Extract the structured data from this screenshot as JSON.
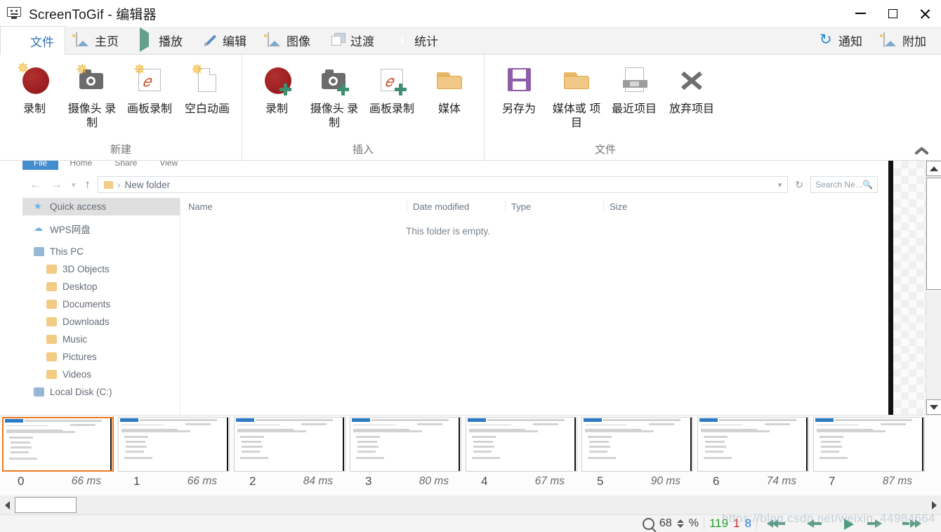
{
  "window": {
    "title": "ScreenToGif - 编辑器",
    "app_icon": "monitor-icon",
    "minimize_label": "最小化",
    "maximize_label": "最大化",
    "close_label": "关闭"
  },
  "ribbon": {
    "tabs": [
      {
        "label": "文件",
        "icon": "save-icon",
        "active": true
      },
      {
        "label": "主页",
        "icon": "picture-icon",
        "active": false
      },
      {
        "label": "播放",
        "icon": "play-icon",
        "active": false
      },
      {
        "label": "编辑",
        "icon": "pencil-icon",
        "active": false
      },
      {
        "label": "图像",
        "icon": "image-icon",
        "active": false
      },
      {
        "label": "过渡",
        "icon": "transition-icon",
        "active": false
      },
      {
        "label": "统计",
        "icon": "info-icon",
        "active": false
      }
    ],
    "right_tabs": [
      {
        "label": "通知",
        "icon": "notification-icon"
      },
      {
        "label": "附加",
        "icon": "addon-icon"
      }
    ],
    "collapse_icon": "chevron-up-icon",
    "groups": [
      {
        "label": "新建",
        "items": [
          {
            "label": "录制",
            "icon": "new-record-icon"
          },
          {
            "label": "摄像头\n录制",
            "icon": "new-webcam-icon"
          },
          {
            "label": "画板录制",
            "icon": "new-board-icon"
          },
          {
            "label": "空白动画",
            "icon": "new-blank-icon"
          }
        ]
      },
      {
        "label": "插入",
        "items": [
          {
            "label": "录制",
            "icon": "insert-record-icon"
          },
          {
            "label": "摄像头\n录制",
            "icon": "insert-webcam-icon"
          },
          {
            "label": "画板录制",
            "icon": "insert-board-icon"
          },
          {
            "label": "媒体",
            "icon": "insert-media-icon"
          }
        ]
      },
      {
        "label": "文件",
        "items": [
          {
            "label": "另存为",
            "icon": "save-as-icon"
          },
          {
            "label": "媒体或\n项目",
            "icon": "open-media-icon"
          },
          {
            "label": "最近项目",
            "icon": "recent-project-icon"
          },
          {
            "label": "放弃项目",
            "icon": "discard-project-icon"
          }
        ]
      }
    ]
  },
  "preview": {
    "explorer": {
      "tabs": [
        "File",
        "Home",
        "Share",
        "View"
      ],
      "address": "New folder",
      "search_placeholder": "Search Ne...",
      "refresh_icon": "refresh-icon",
      "sidebar": [
        {
          "label": "Quick access",
          "icon": "star-icon",
          "selected": true,
          "indent": false
        },
        {
          "label": "WPS网盘",
          "icon": "cloud-icon",
          "selected": false,
          "indent": false
        },
        {
          "label": "This PC",
          "icon": "pc-icon",
          "selected": false,
          "indent": false
        },
        {
          "label": "3D Objects",
          "icon": "folder-3d-icon",
          "selected": false,
          "indent": true
        },
        {
          "label": "Desktop",
          "icon": "folder-desktop-icon",
          "selected": false,
          "indent": true
        },
        {
          "label": "Documents",
          "icon": "folder-documents-icon",
          "selected": false,
          "indent": true
        },
        {
          "label": "Downloads",
          "icon": "folder-downloads-icon",
          "selected": false,
          "indent": true
        },
        {
          "label": "Music",
          "icon": "folder-music-icon",
          "selected": false,
          "indent": true
        },
        {
          "label": "Pictures",
          "icon": "folder-pictures-icon",
          "selected": false,
          "indent": true
        },
        {
          "label": "Videos",
          "icon": "folder-videos-icon",
          "selected": false,
          "indent": true
        },
        {
          "label": "Local Disk (C:)",
          "icon": "disk-icon",
          "selected": false,
          "indent": false
        }
      ],
      "columns": [
        "Name",
        "Date modified",
        "Type",
        "Size"
      ],
      "empty_message": "This folder is empty."
    }
  },
  "frames": [
    {
      "index": "0",
      "duration": "66 ms",
      "selected": true
    },
    {
      "index": "1",
      "duration": "66 ms",
      "selected": false
    },
    {
      "index": "2",
      "duration": "84 ms",
      "selected": false
    },
    {
      "index": "3",
      "duration": "80 ms",
      "selected": false
    },
    {
      "index": "4",
      "duration": "67 ms",
      "selected": false
    },
    {
      "index": "5",
      "duration": "90 ms",
      "selected": false
    },
    {
      "index": "6",
      "duration": "74 ms",
      "selected": false
    },
    {
      "index": "7",
      "duration": "87 ms",
      "selected": false
    }
  ],
  "statusbar": {
    "zoom_icon": "magnifier-icon",
    "zoom_value": "68",
    "zoom_unit": "%",
    "total_frames": "119",
    "selected_count": "1",
    "current_frame": "8",
    "colors": {
      "total": "#2ca02c",
      "selected": "#d12424",
      "current": "#2b7cd3"
    },
    "nav": [
      {
        "name": "first-frame-button",
        "icon": "double-left-icon"
      },
      {
        "name": "previous-frame-button",
        "icon": "left-icon"
      },
      {
        "name": "play-button",
        "icon": "play-icon"
      },
      {
        "name": "next-frame-button",
        "icon": "right-icon"
      },
      {
        "name": "last-frame-button",
        "icon": "double-right-icon"
      }
    ]
  },
  "watermark": "https://blog.csdn.net/weixin_44984664"
}
